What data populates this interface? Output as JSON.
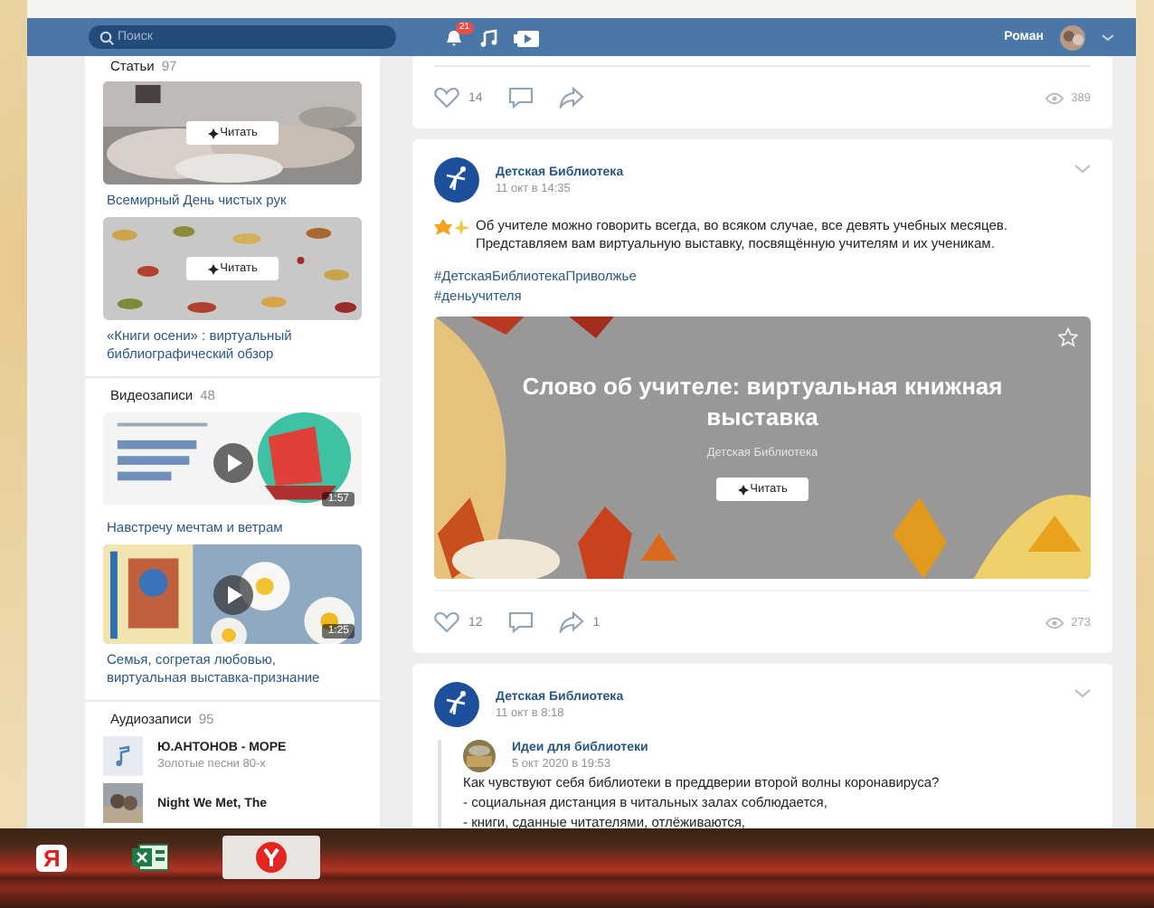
{
  "topbar": {
    "search": {
      "placeholder": "Поиск"
    },
    "notifications_badge": "21",
    "user_name": "Роман"
  },
  "sidebar": {
    "articles": {
      "title": "Статьи",
      "count": "97",
      "items": [
        {
          "title": "Всемирный День чистых рук",
          "button": "Читать"
        },
        {
          "kind": "pattern",
          "title": "«Книги осени» : виртуальный библиографический обзор",
          "button": "Читать"
        }
      ]
    },
    "videos": {
      "title": "Видеозаписи",
      "count": "48",
      "items": [
        {
          "kind": "ship",
          "title": "Навстречу мечтам и ветрам",
          "duration": "1:57"
        },
        {
          "kind": "daisies",
          "title": "Семья, согретая любовью, виртуальная выставка-признание",
          "duration": "1:25"
        }
      ]
    },
    "audio": {
      "title": "Аудиозаписи",
      "count": "95",
      "items": [
        {
          "kind": "note",
          "title": "Ю.АНТОНОВ - МОРЕ",
          "subtitle": "Золотые песни 80-х"
        },
        {
          "kind": "cover",
          "title": "Night We Met, The"
        }
      ]
    }
  },
  "feed": [
    {
      "kind": "tail",
      "actions": {
        "likes": "14",
        "views": "389"
      }
    },
    {
      "kind": "post",
      "author": "Детская Библиотека",
      "date": "11 окт в 14:35",
      "text": "Об учителе можно говорить всегда, во всяком случае, все девять учебных месяцев. Представляем вам виртуальную выставку, посвящённую учителям и их ученикам.",
      "hashtags": [
        "#ДетскаяБиблиотекаПриволжье",
        "#деньучителя"
      ],
      "article": {
        "title": "Слово об учителе: виртуальная книжная выставка",
        "source": "Детская Библиотека",
        "button": "Читать"
      },
      "actions": {
        "likes": "12",
        "shares": "1",
        "views": "273"
      }
    },
    {
      "kind": "post",
      "author": "Детская Библиотека",
      "date": "11 окт в 8:18",
      "repost": {
        "author": "Идеи для библиотеки",
        "date": "5 окт 2020 в 19:53",
        "lines": [
          "Как чувствуют себя библиотеки в преддверии второй волны коронавируса?",
          "- социальная дистанция в читальных залах соблюдается,",
          "- книги, сданные читателями, отлёживаются,"
        ]
      }
    }
  ],
  "taskbar": {
    "apps": [
      {
        "kind": "yandex",
        "label": "Я",
        "selected": false
      },
      {
        "kind": "excel",
        "selected": false
      },
      {
        "kind": "browser",
        "selected": true
      }
    ]
  }
}
